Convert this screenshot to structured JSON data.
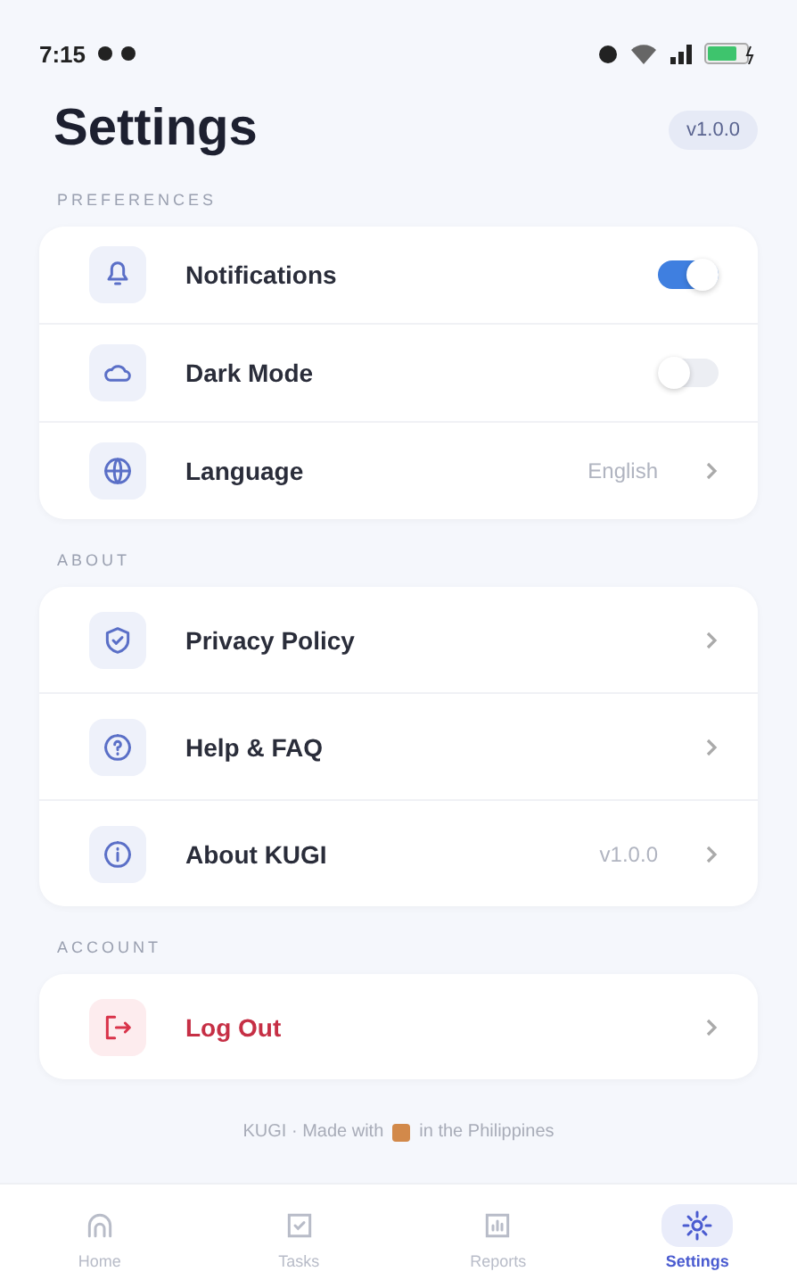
{
  "status_bar": {
    "time": "7:15"
  },
  "header": {
    "title": "Settings",
    "version_badge": "v1.0.0"
  },
  "sections": [
    {
      "title": "PREFERENCES",
      "items": [
        {
          "label": "Notifications",
          "kind": "toggle",
          "on": true
        },
        {
          "label": "Dark Mode",
          "kind": "toggle",
          "on": false
        },
        {
          "label": "Language",
          "kind": "value",
          "value": "English"
        }
      ]
    },
    {
      "title": "ABOUT",
      "items": [
        {
          "label": "Privacy Policy",
          "kind": "link"
        },
        {
          "label": "Help & FAQ",
          "kind": "link"
        },
        {
          "label": "About KUGI",
          "kind": "value",
          "value": "v1.0.0"
        }
      ]
    },
    {
      "title": "ACCOUNT",
      "items": [
        {
          "label": "Log Out",
          "kind": "danger"
        }
      ]
    }
  ],
  "footer": {
    "before": "KUGI · Made with",
    "after": "in the Philippines"
  },
  "tabs": [
    {
      "label": "Home",
      "selected": false
    },
    {
      "label": "Tasks",
      "selected": false
    },
    {
      "label": "Reports",
      "selected": false
    },
    {
      "label": "Settings",
      "selected": true
    }
  ]
}
